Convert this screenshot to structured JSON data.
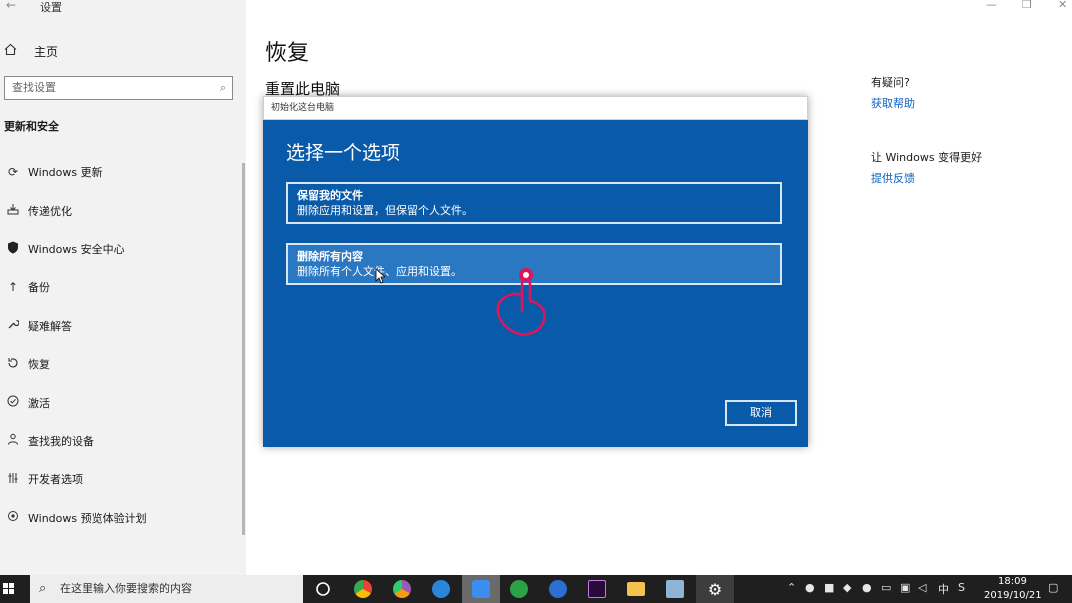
{
  "window": {
    "app_title": "设置",
    "back_icon": "back-arrow-icon",
    "controls": [
      "minimize-icon",
      "restore-icon",
      "close-icon"
    ]
  },
  "sidebar": {
    "home_label": "主页",
    "search_placeholder": "查找设置",
    "section_heading": "更新和安全",
    "items": [
      {
        "label": "Windows 更新",
        "icon": "refresh-icon"
      },
      {
        "label": "传递优化",
        "icon": "delivery-icon"
      },
      {
        "label": "Windows 安全中心",
        "icon": "shield-icon"
      },
      {
        "label": "备份",
        "icon": "backup-arrow-icon"
      },
      {
        "label": "疑难解答",
        "icon": "wrench-icon"
      },
      {
        "label": "恢复",
        "icon": "recovery-icon"
      },
      {
        "label": "激活",
        "icon": "checkmark-circle-icon"
      },
      {
        "label": "查找我的设备",
        "icon": "person-locate-icon"
      },
      {
        "label": "开发者选项",
        "icon": "developer-icon"
      },
      {
        "label": "Windows 预览体验计划",
        "icon": "insider-icon"
      }
    ]
  },
  "main": {
    "page_title": "恢复",
    "section_title": "重置此电脑",
    "help_question": "有疑问?",
    "help_link": "获取帮助",
    "improve_question": "让 Windows 变得更好",
    "feedback_link": "提供反馈"
  },
  "dialog": {
    "titlebar": "初始化这台电脑",
    "heading": "选择一个选项",
    "options": [
      {
        "title": "保留我的文件",
        "desc": "删除应用和设置，但保留个人文件。"
      },
      {
        "title": "删除所有内容",
        "desc": "删除所有个人文件、应用和设置。"
      }
    ],
    "cancel_label": "取消"
  },
  "taskbar": {
    "search_placeholder": "在这里输入你要搜索的内容",
    "time": "18:09",
    "date": "2019/10/21",
    "ime": "中",
    "colors": {
      "bg": "#1f1f1f",
      "accent": "#0a5aaa",
      "link": "#0a62c4"
    }
  }
}
